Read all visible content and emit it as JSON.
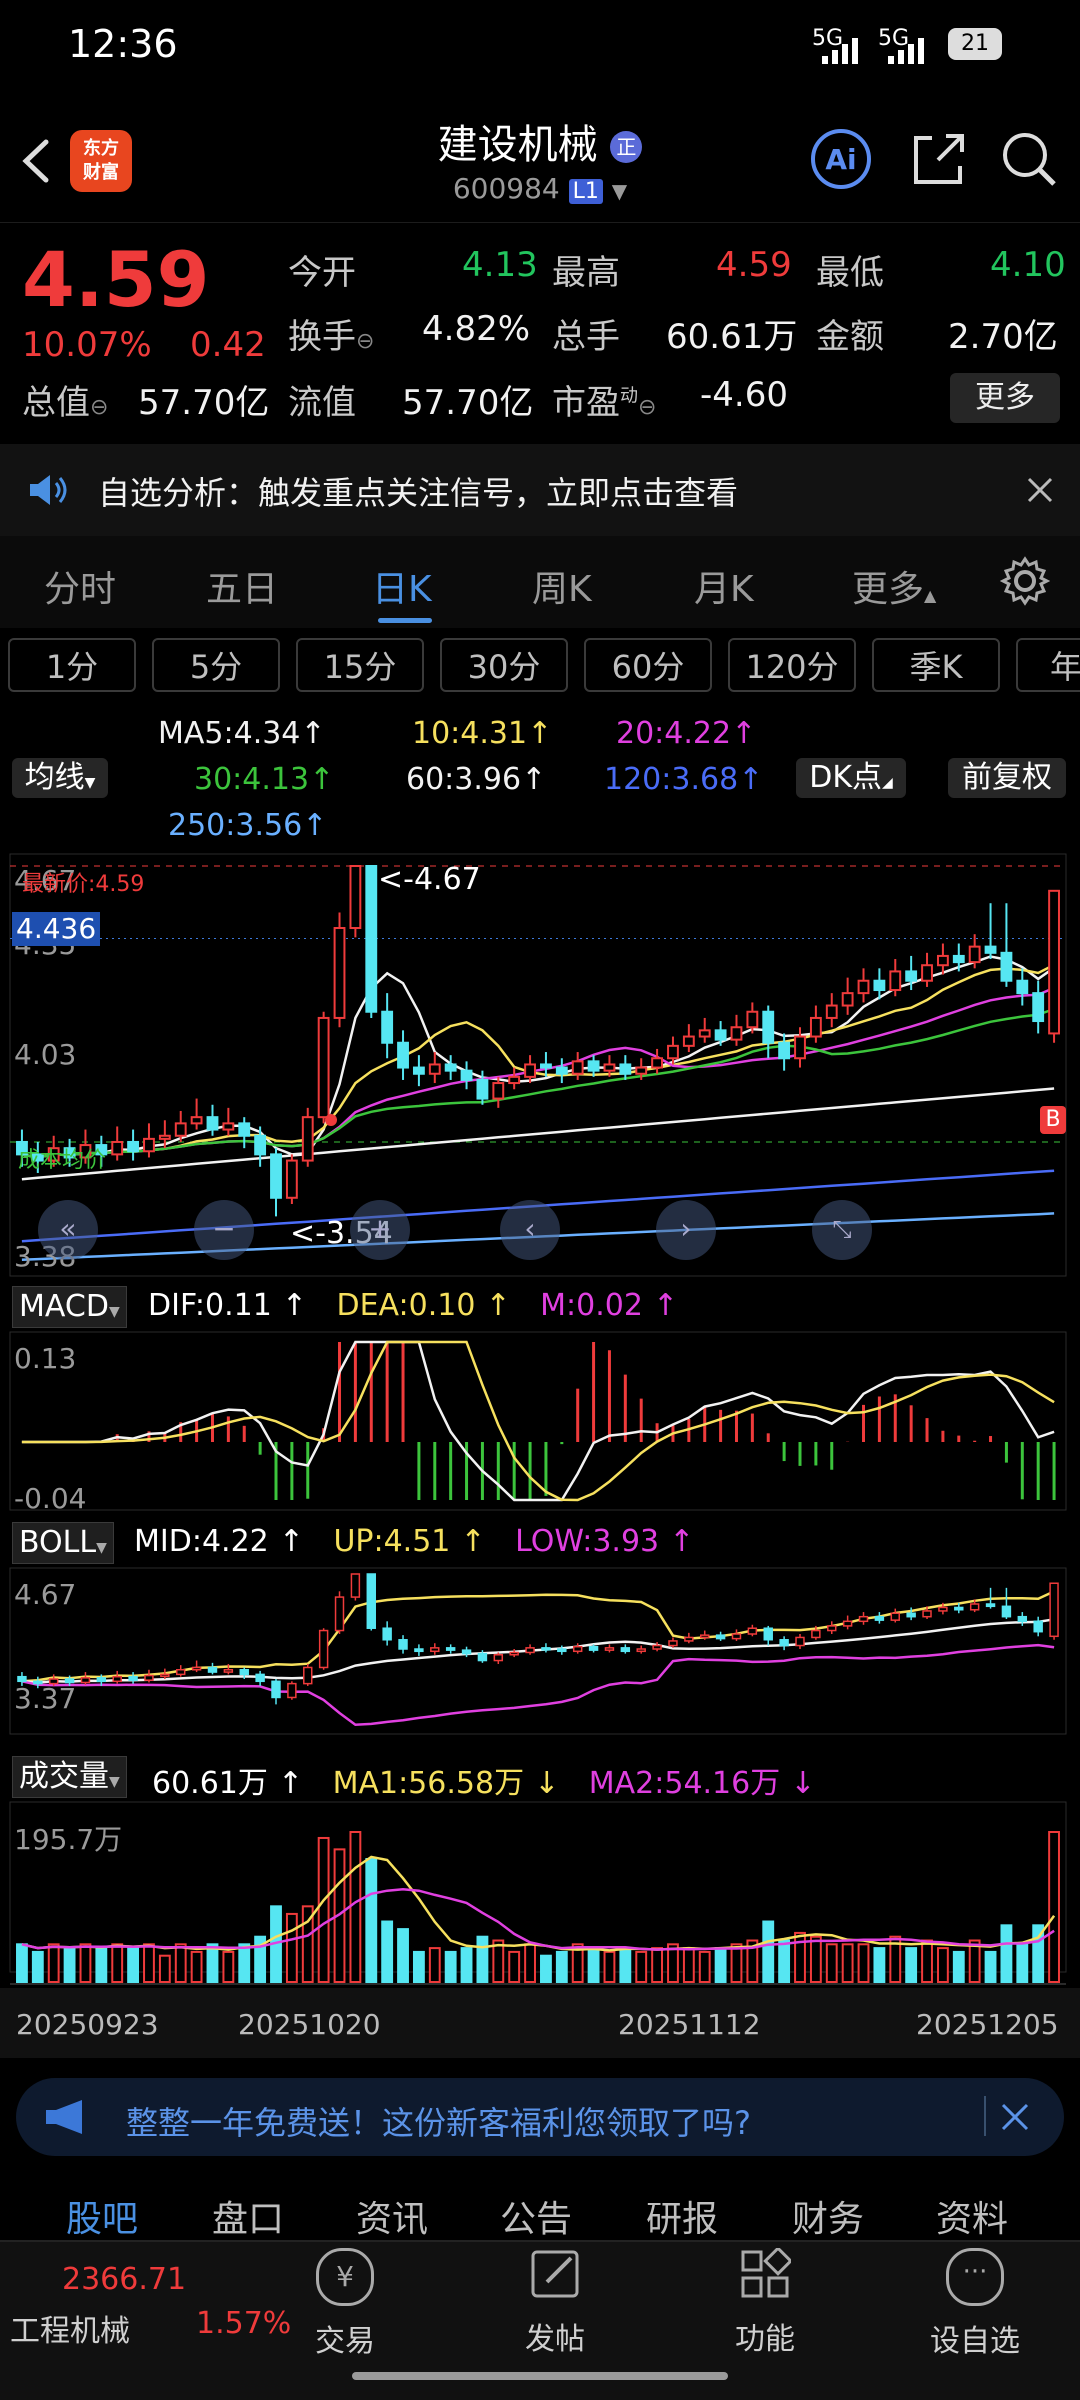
{
  "status_bar": {
    "time": "12:36",
    "signal1": "5G",
    "signal2": "5G",
    "battery": "21"
  },
  "header": {
    "logo_text_1": "东方",
    "logo_text_2": "财富",
    "stock_name": "建设机械",
    "name_badge": "正",
    "stock_code": "600984",
    "level_badge": "L1",
    "icons": [
      "back-icon",
      "ai-icon",
      "share-icon",
      "search-icon"
    ],
    "ai_label": "Ai"
  },
  "quote": {
    "price": "4.59",
    "change_pct": "10.07%",
    "change": "0.42",
    "fields": [
      {
        "label": "今开",
        "value": "4.13",
        "color": "green"
      },
      {
        "label": "最高",
        "value": "4.59",
        "color": "red"
      },
      {
        "label": "最低",
        "value": "4.10",
        "color": "green"
      },
      {
        "label": "换手",
        "value": "4.82%",
        "color": "white"
      },
      {
        "label": "总手",
        "value": "60.61万",
        "color": "white"
      },
      {
        "label": "金额",
        "value": "2.70亿",
        "color": "white"
      },
      {
        "label": "总值",
        "value": "57.70亿",
        "color": "white"
      },
      {
        "label": "流值",
        "value": "57.70亿",
        "color": "white"
      },
      {
        "label": "市盈",
        "label_sup": "动",
        "value": "-4.60",
        "color": "white"
      }
    ],
    "more_label": "更多"
  },
  "notice": {
    "text": "自选分析：触发重点关注信号，立即点击查看"
  },
  "tabs": [
    "分时",
    "五日",
    "日K",
    "周K",
    "月K",
    "更多"
  ],
  "active_tab": "日K",
  "periods": [
    "1分",
    "5分",
    "15分",
    "30分",
    "60分",
    "120分",
    "季K",
    "年"
  ],
  "ma_legend": {
    "selector": "均线",
    "items": [
      {
        "text": "MA5:4.34",
        "arrow": "↑",
        "color": "#f2f2f2"
      },
      {
        "text": "10:4.31",
        "arrow": "↑",
        "color": "#f6e05e"
      },
      {
        "text": "20:4.22",
        "arrow": "↑",
        "color": "#e040e0"
      },
      {
        "text": "30:4.13",
        "arrow": "↑",
        "color": "#3cc43c"
      },
      {
        "text": "60:3.96",
        "arrow": "↑",
        "color": "#f2f2f2"
      },
      {
        "text": "120:3.68",
        "arrow": "↑",
        "color": "#4a6cf7"
      },
      {
        "text": "250:3.56",
        "arrow": "↑",
        "color": "#6ab0ff"
      }
    ],
    "dk_label": "DK点",
    "adjust_label": "前复权"
  },
  "kline": {
    "y_labels": [
      "4.67",
      "4.35",
      "4.03",
      "3.38"
    ],
    "current_price_label": "最新价:4.59",
    "cursor_price": "4.436",
    "high_annotation": "<-4.67",
    "low_annotation": "<-3.54",
    "cost_label": "成本均价",
    "buy_marker": "B",
    "nav_icons": [
      "rewind-icon",
      "zoom-out-icon",
      "zoom-in-icon",
      "prev-icon",
      "next-icon",
      "fullscreen-icon"
    ]
  },
  "macd": {
    "selector": "MACD",
    "dif": "DIF:0.11",
    "dif_arrow": "↑",
    "dea": "DEA:0.10",
    "dea_arrow": "↑",
    "m": "M:0.02",
    "m_arrow": "↑",
    "y_top": "0.13",
    "y_bottom": "-0.04"
  },
  "boll": {
    "selector": "BOLL",
    "mid": "MID:4.22",
    "mid_arrow": "↑",
    "up": "UP:4.51",
    "up_arrow": "↑",
    "low": "LOW:3.93",
    "low_arrow": "↑",
    "y_top": "4.67",
    "y_bottom": "3.37"
  },
  "volume": {
    "selector": "成交量",
    "value": "60.61万",
    "value_arrow": "↑",
    "ma1": "MA1:56.58万",
    "ma1_arrow": "↓",
    "ma2": "MA2:54.16万",
    "ma2_arrow": "↓",
    "y_top": "195.7万"
  },
  "dates": [
    "20250923",
    "20251020",
    "20251112",
    "20251205"
  ],
  "ad": {
    "text": "整整一年免费送！这份新客福利您领取了吗?"
  },
  "bottom_tabs": [
    "股吧",
    "盘口",
    "资讯",
    "公告",
    "研报",
    "财务",
    "资料"
  ],
  "active_bottom_tab": "股吧",
  "toolbar": {
    "index_value": "2366.71",
    "index_name": "工程机械",
    "index_change": "1.57%",
    "items": [
      "交易",
      "发帖",
      "功能",
      "设自选"
    ]
  },
  "chart_data": {
    "type": "candlestick",
    "candles": [
      [
        3.78,
        3.74,
        3.82,
        3.7
      ],
      [
        3.74,
        3.72,
        3.78,
        3.68
      ],
      [
        3.72,
        3.76,
        3.8,
        3.7
      ],
      [
        3.76,
        3.73,
        3.79,
        3.7
      ],
      [
        3.73,
        3.77,
        3.82,
        3.71
      ],
      [
        3.77,
        3.74,
        3.8,
        3.7
      ],
      [
        3.74,
        3.78,
        3.83,
        3.72
      ],
      [
        3.78,
        3.75,
        3.82,
        3.72
      ],
      [
        3.75,
        3.79,
        3.84,
        3.73
      ],
      [
        3.79,
        3.8,
        3.85,
        3.76
      ],
      [
        3.8,
        3.84,
        3.88,
        3.78
      ],
      [
        3.84,
        3.86,
        3.92,
        3.82
      ],
      [
        3.86,
        3.82,
        3.9,
        3.8
      ],
      [
        3.82,
        3.84,
        3.89,
        3.8
      ],
      [
        3.84,
        3.8,
        3.86,
        3.76
      ],
      [
        3.8,
        3.74,
        3.83,
        3.7
      ],
      [
        3.74,
        3.6,
        3.76,
        3.54
      ],
      [
        3.6,
        3.72,
        3.74,
        3.58
      ],
      [
        3.72,
        3.86,
        3.89,
        3.7
      ],
      [
        3.86,
        4.18,
        4.2,
        3.84
      ],
      [
        4.18,
        4.47,
        4.52,
        4.15
      ],
      [
        4.47,
        4.67,
        4.67,
        4.44
      ],
      [
        4.67,
        4.2,
        4.67,
        4.18
      ],
      [
        4.2,
        4.1,
        4.26,
        4.05
      ],
      [
        4.1,
        4.02,
        4.14,
        3.98
      ],
      [
        4.02,
        4.0,
        4.06,
        3.96
      ],
      [
        4.0,
        4.03,
        4.07,
        3.97
      ],
      [
        4.03,
        4.01,
        4.06,
        3.98
      ],
      [
        4.01,
        3.98,
        4.04,
        3.95
      ],
      [
        3.98,
        3.92,
        4.01,
        3.9
      ],
      [
        3.92,
        3.97,
        3.99,
        3.89
      ],
      [
        3.97,
        3.99,
        4.02,
        3.95
      ],
      [
        3.99,
        4.03,
        4.06,
        3.97
      ],
      [
        4.03,
        4.02,
        4.07,
        3.99
      ],
      [
        4.02,
        4.0,
        4.05,
        3.97
      ],
      [
        4.0,
        4.04,
        4.07,
        3.98
      ],
      [
        4.04,
        4.01,
        4.06,
        3.99
      ],
      [
        4.01,
        4.03,
        4.06,
        3.99
      ],
      [
        4.03,
        4.0,
        4.06,
        3.98
      ],
      [
        4.0,
        4.02,
        4.05,
        3.98
      ],
      [
        4.02,
        4.05,
        4.08,
        4.0
      ],
      [
        4.05,
        4.09,
        4.12,
        4.03
      ],
      [
        4.09,
        4.12,
        4.16,
        4.07
      ],
      [
        4.12,
        4.14,
        4.18,
        4.1
      ],
      [
        4.14,
        4.11,
        4.17,
        4.09
      ],
      [
        4.11,
        4.15,
        4.19,
        4.09
      ],
      [
        4.15,
        4.2,
        4.23,
        4.13
      ],
      [
        4.2,
        4.1,
        4.22,
        4.05
      ],
      [
        4.1,
        4.05,
        4.13,
        4.01
      ],
      [
        4.05,
        4.12,
        4.15,
        4.02
      ],
      [
        4.12,
        4.18,
        4.22,
        4.1
      ],
      [
        4.18,
        4.22,
        4.26,
        4.15
      ],
      [
        4.22,
        4.26,
        4.31,
        4.19
      ],
      [
        4.26,
        4.3,
        4.34,
        4.23
      ],
      [
        4.3,
        4.27,
        4.34,
        4.24
      ],
      [
        4.27,
        4.33,
        4.37,
        4.25
      ],
      [
        4.33,
        4.3,
        4.38,
        4.27
      ],
      [
        4.3,
        4.35,
        4.39,
        4.28
      ],
      [
        4.35,
        4.38,
        4.42,
        4.32
      ],
      [
        4.38,
        4.36,
        4.42,
        4.33
      ],
      [
        4.36,
        4.41,
        4.45,
        4.34
      ],
      [
        4.41,
        4.39,
        4.55,
        4.37
      ],
      [
        4.39,
        4.3,
        4.55,
        4.28
      ],
      [
        4.3,
        4.26,
        4.34,
        4.22
      ],
      [
        4.26,
        4.17,
        4.3,
        4.13
      ],
      [
        4.13,
        4.59,
        4.59,
        4.1
      ]
    ]
  }
}
